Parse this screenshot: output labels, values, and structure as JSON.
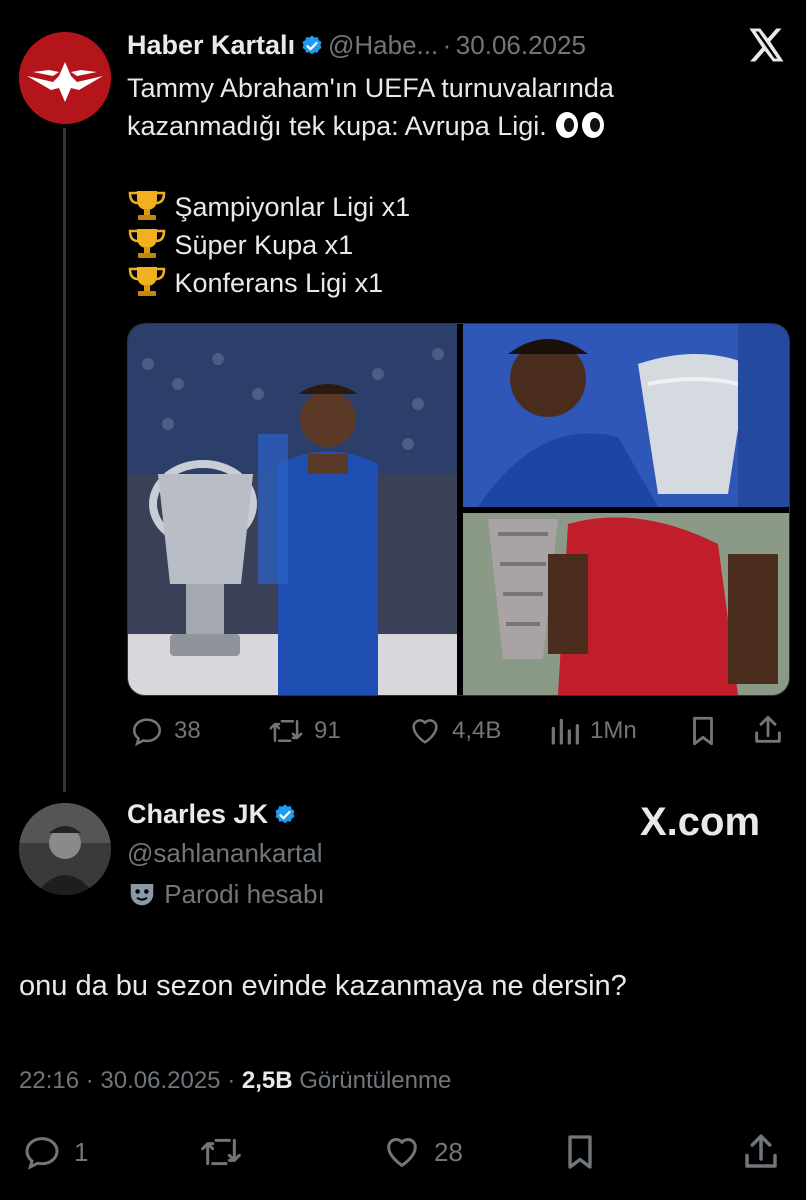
{
  "tweet": {
    "author_name": "Haber Kartalı",
    "handle": "@Habe...",
    "separator": "·",
    "date": "30.06.2025",
    "text_line1": "Tammy Abraham'ın UEFA turnuvalarında",
    "text_line2": "kazanmadığı tek kupa: Avrupa Ligi.",
    "trophies": [
      "Şampiyonlar Ligi x1",
      "Süper Kupa x1",
      "Konferans Ligi x1"
    ],
    "stats": {
      "replies": "38",
      "retweets": "91",
      "likes": "4,4B",
      "views": "1Mn"
    }
  },
  "reply": {
    "author_name": "Charles JK",
    "handle": "@sahlanankartal",
    "parody_label": "Parodi hesabı",
    "text": "onu da bu sezon evinde kazanmaya ne dersin?",
    "time": "22:16",
    "separator": "·",
    "date": "30.06.2025",
    "views_count": "2,5B",
    "views_label": "Görüntülenme",
    "stats": {
      "replies": "1",
      "likes": "28"
    }
  },
  "watermark": "X.com",
  "colors": {
    "background": "#000000",
    "text": "#e7e9ea",
    "muted": "#71767b",
    "verified": "#1d9bf0",
    "avatar_red": "#b3151b"
  },
  "icons": [
    "x-logo-icon",
    "verified-icon",
    "eyes-emoji-icon",
    "trophy-icon",
    "reply-icon",
    "retweet-icon",
    "like-icon",
    "views-icon",
    "bookmark-icon",
    "share-icon",
    "parody-mask-icon"
  ]
}
